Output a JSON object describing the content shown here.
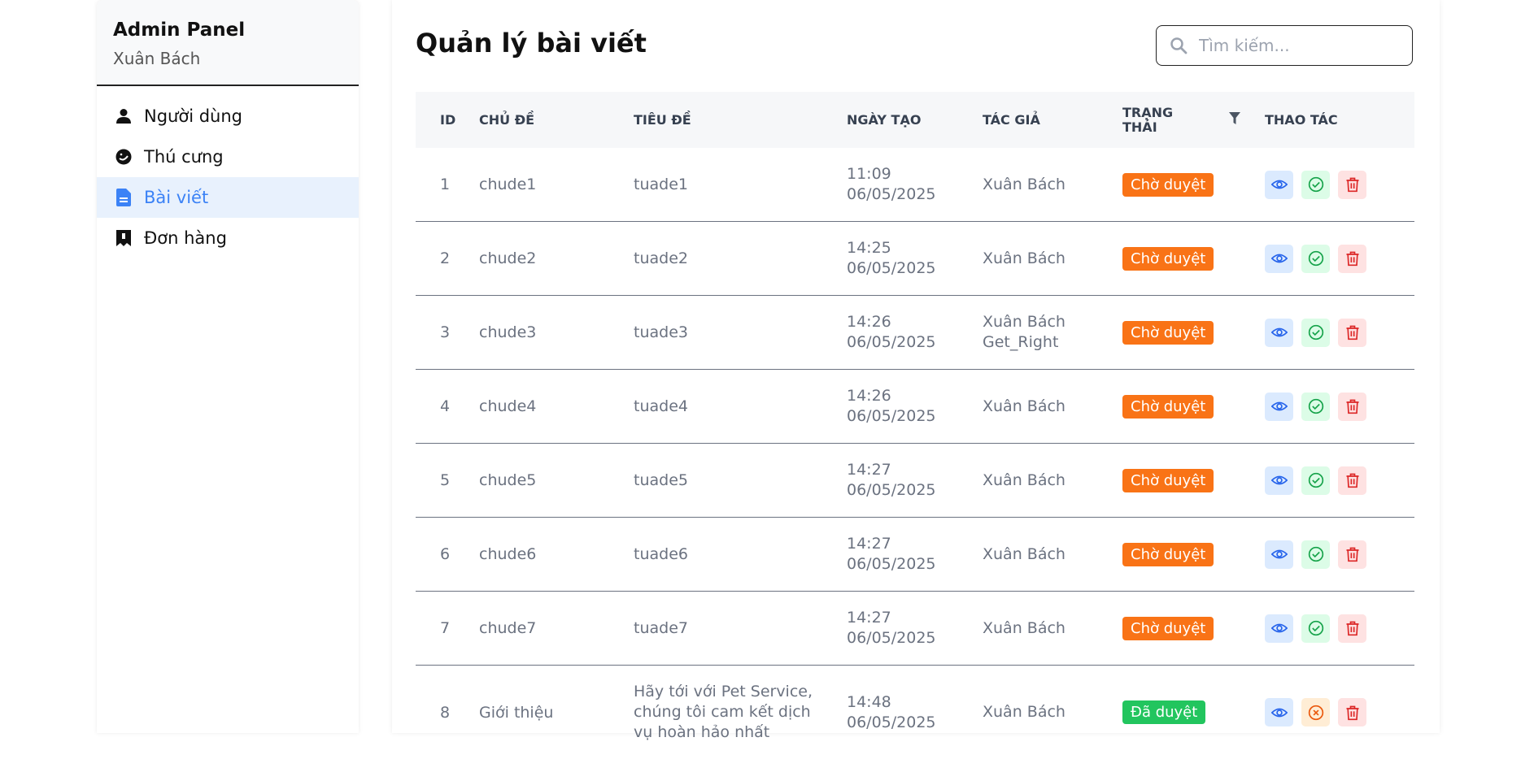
{
  "sidebar": {
    "title": "Admin Panel",
    "user": "Xuân Bách",
    "items": [
      {
        "label": "Người dùng",
        "icon": "user-icon"
      },
      {
        "label": "Thú cưng",
        "icon": "pet-icon"
      },
      {
        "label": "Bài viết",
        "icon": "document-icon",
        "active": true
      },
      {
        "label": "Đơn hàng",
        "icon": "order-icon"
      }
    ]
  },
  "main": {
    "title": "Quản lý bài viết",
    "search": {
      "placeholder": "Tìm kiếm..."
    }
  },
  "table": {
    "headers": {
      "id": "ID",
      "topic": "CHỦ ĐỀ",
      "title": "TIÊU ĐỀ",
      "date": "NGÀY TẠO",
      "author": "TÁC GIẢ",
      "status": "TRẠNG THÁI",
      "actions": "THAO TÁC"
    },
    "rows": [
      {
        "id": "1",
        "topic": "chude1",
        "title": "tuade1",
        "time": "11:09",
        "date": "06/05/2025",
        "author": "Xuân Bách",
        "status": "Chờ duyệt",
        "status_type": "pending"
      },
      {
        "id": "2",
        "topic": "chude2",
        "title": "tuade2",
        "time": "14:25",
        "date": "06/05/2025",
        "author": "Xuân Bách",
        "status": "Chờ duyệt",
        "status_type": "pending"
      },
      {
        "id": "3",
        "topic": "chude3",
        "title": "tuade3",
        "time": "14:26",
        "date": "06/05/2025",
        "author": "Xuân Bách Get_Right",
        "status": "Chờ duyệt",
        "status_type": "pending"
      },
      {
        "id": "4",
        "topic": "chude4",
        "title": "tuade4",
        "time": "14:26",
        "date": "06/05/2025",
        "author": "Xuân Bách",
        "status": "Chờ duyệt",
        "status_type": "pending"
      },
      {
        "id": "5",
        "topic": "chude5",
        "title": "tuade5",
        "time": "14:27",
        "date": "06/05/2025",
        "author": "Xuân Bách",
        "status": "Chờ duyệt",
        "status_type": "pending"
      },
      {
        "id": "6",
        "topic": "chude6",
        "title": "tuade6",
        "time": "14:27",
        "date": "06/05/2025",
        "author": "Xuân Bách",
        "status": "Chờ duyệt",
        "status_type": "pending"
      },
      {
        "id": "7",
        "topic": "chude7",
        "title": "tuade7",
        "time": "14:27",
        "date": "06/05/2025",
        "author": "Xuân Bách",
        "status": "Chờ duyệt",
        "status_type": "pending"
      },
      {
        "id": "8",
        "topic": "Giới thiệu",
        "title": "Hãy tới với Pet Service, chúng tôi cam kết dịch vụ hoàn hảo nhất",
        "time": "14:48",
        "date": "06/05/2025",
        "author": "Xuân Bách",
        "status": "Đã duyệt",
        "status_type": "approved"
      }
    ]
  },
  "colors": {
    "accent": "#3b82f6",
    "pending": "#f97316",
    "approved": "#22c55e",
    "danger": "#dc2626"
  }
}
